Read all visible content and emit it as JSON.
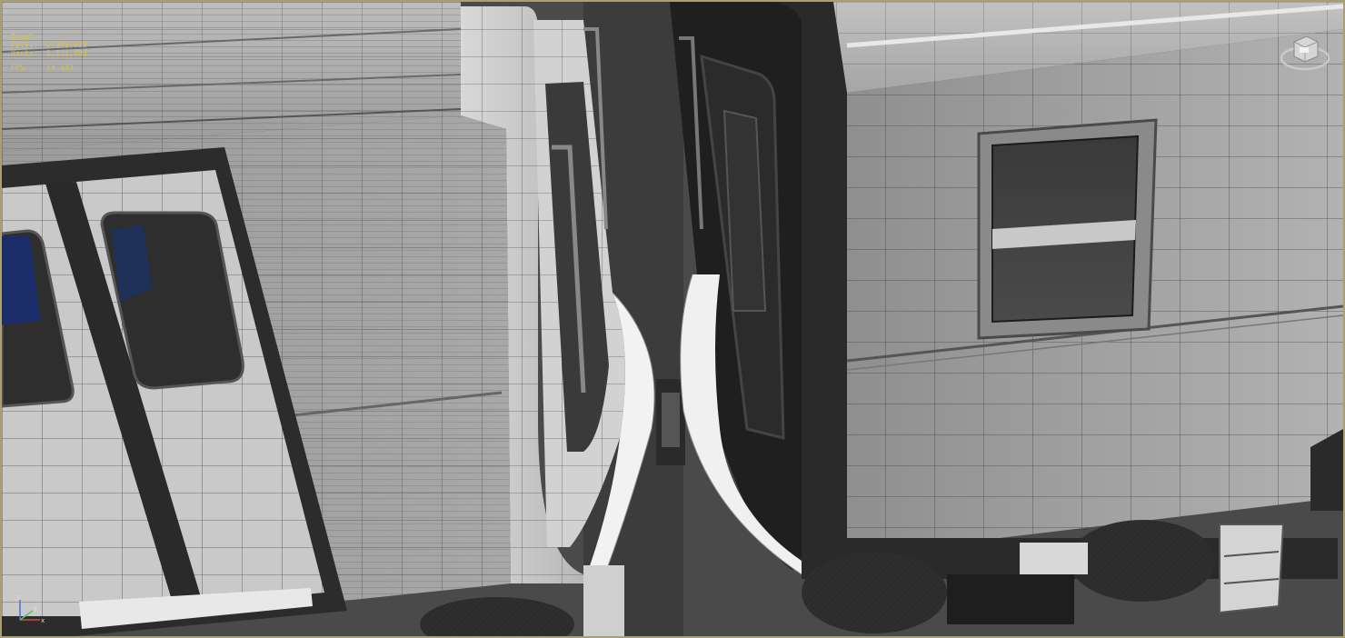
{
  "viewport": {
    "name": "Perspective",
    "shading": "Wireframe + Shaded",
    "frame_color": "#a8a072",
    "stats_color": "#d8c24a"
  },
  "stats": {
    "header": "Total",
    "rows": [
      {
        "label": "Polys:",
        "value": "2,326,022"
      },
      {
        "label": "Verts:",
        "value": "1,171,493"
      }
    ],
    "fps_label": "FPS:",
    "fps_value": "14.143"
  },
  "gizmo": {
    "x_axis": "x",
    "y_axis": "y",
    "z_axis": "z"
  },
  "viewcube": {
    "icon": "viewcube-icon"
  }
}
